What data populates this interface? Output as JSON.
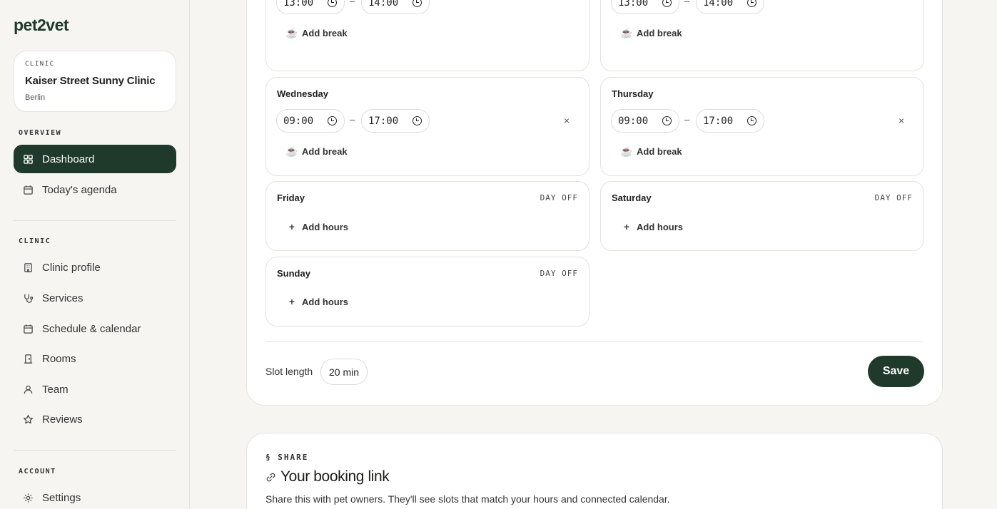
{
  "brand": {
    "logo": "pet2vet"
  },
  "clinic_card": {
    "kicker": "CLINIC",
    "name": "Kaiser Street Sunny Clinic",
    "city": "Berlin"
  },
  "sidebar": {
    "overview_label": "OVERVIEW",
    "overview_items": [
      {
        "label": "Dashboard",
        "icon": "grid-icon",
        "active": true
      },
      {
        "label": "Today's agenda",
        "icon": "calendar-icon"
      }
    ],
    "clinic_label": "CLINIC",
    "clinic_items": [
      {
        "label": "Clinic profile",
        "icon": "building-icon"
      },
      {
        "label": "Services",
        "icon": "stethoscope-icon"
      },
      {
        "label": "Schedule & calendar",
        "icon": "calendar-icon"
      },
      {
        "label": "Rooms",
        "icon": "door-icon"
      },
      {
        "label": "Team",
        "icon": "users-icon"
      },
      {
        "label": "Reviews",
        "icon": "star-icon"
      }
    ],
    "account_label": "ACCOUNT",
    "account_items": [
      {
        "label": "Settings",
        "icon": "gear-icon"
      }
    ]
  },
  "schedule": {
    "top_row": [
      {
        "break_start": "13:00",
        "break_end": "14:00",
        "add_break": "Add break"
      },
      {
        "break_start": "13:00",
        "break_end": "14:00",
        "add_break": "Add break"
      }
    ],
    "days": {
      "wednesday": {
        "name": "Wednesday",
        "start": "09:00",
        "end": "17:00",
        "add_break": "Add break"
      },
      "thursday": {
        "name": "Thursday",
        "start": "09:00",
        "end": "17:00",
        "add_break": "Add break"
      },
      "friday": {
        "name": "Friday",
        "status": "DAY OFF",
        "add_hours": "Add hours"
      },
      "saturday": {
        "name": "Saturday",
        "status": "DAY OFF",
        "add_hours": "Add hours"
      },
      "sunday": {
        "name": "Sunday",
        "status": "DAY OFF",
        "add_hours": "Add hours"
      }
    },
    "dash": "–",
    "slot_label": "Slot length",
    "slot_value": "20 min",
    "save_label": "Save"
  },
  "share": {
    "kicker": "§ SHARE",
    "title": "Your booking link",
    "description": "Share this with pet owners. They'll see slots that match your hours and connected calendar."
  },
  "colors": {
    "accent": "#1f3a2a",
    "background": "#f6f5f2"
  }
}
